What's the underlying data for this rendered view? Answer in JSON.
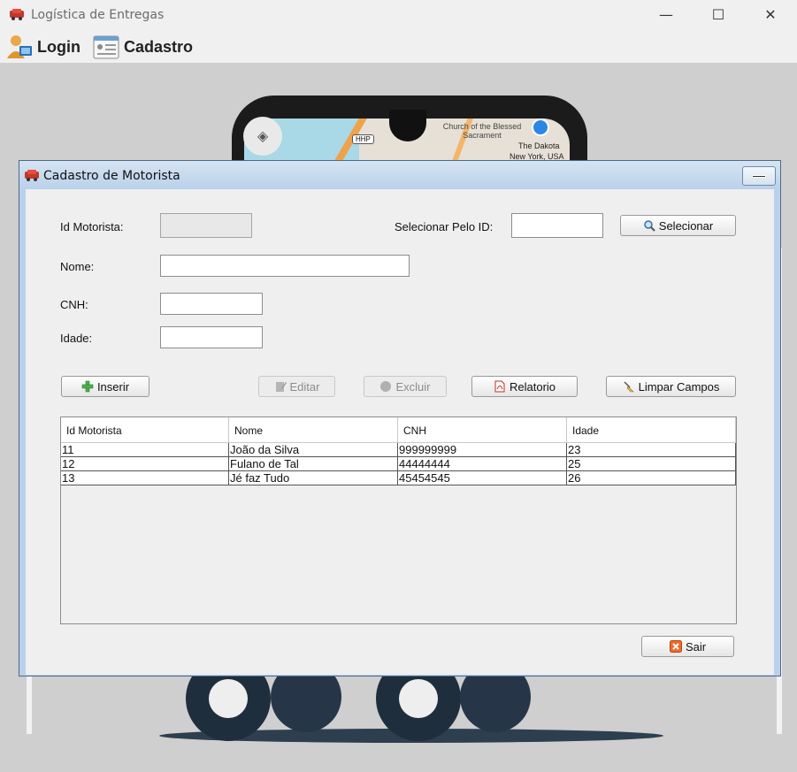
{
  "window": {
    "title": "Logística de Entregas",
    "minimize_glyph": "—",
    "maximize_glyph": "☐",
    "close_glyph": "✕"
  },
  "menu": {
    "login_label": "Login",
    "cadastro_label": "Cadastro"
  },
  "background": {
    "map_church": "Church of the Blessed Sacrament",
    "map_dakota": "The Dakota",
    "map_city": "New York, USA",
    "map_route": "HHP"
  },
  "frame": {
    "title": "Cadastro de Motorista"
  },
  "form": {
    "id_label": "Id Motorista:",
    "id_value": "",
    "select_by_id_label": "Selecionar Pelo ID:",
    "select_by_id_value": "",
    "select_button": "Selecionar",
    "nome_label": "Nome:",
    "nome_value": "",
    "cnh_label": "CNH:",
    "cnh_value": "",
    "idade_label": "Idade:",
    "idade_value": ""
  },
  "actions": {
    "inserir": "Inserir",
    "editar": "Editar",
    "excluir": "Excluir",
    "relatorio": "Relatorio",
    "limpar": "Limpar Campos",
    "sair": "Sair"
  },
  "table": {
    "columns": [
      "Id Motorista",
      "Nome",
      "CNH",
      "Idade"
    ],
    "rows": [
      [
        "11",
        "João da Silva",
        "999999999",
        "23"
      ],
      [
        "12",
        "Fulano de Tal",
        "44444444",
        "25"
      ],
      [
        "13",
        "Jé faz Tudo",
        "45454545",
        "26"
      ]
    ]
  }
}
